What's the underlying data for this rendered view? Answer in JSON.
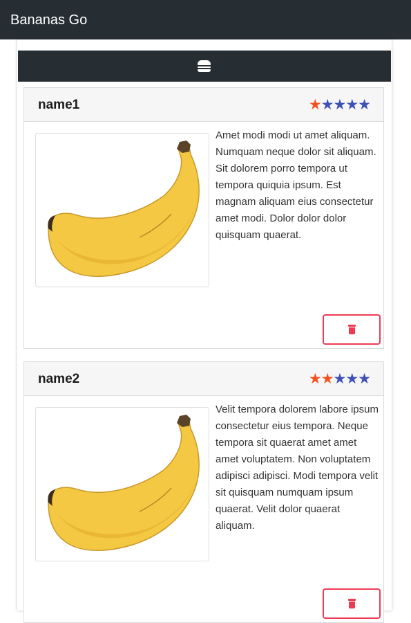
{
  "app": {
    "title": "Bananas Go"
  },
  "menu": {
    "icon": "hamburger-icon"
  },
  "cards": [
    {
      "name": "name1",
      "rating": 1,
      "max_rating": 5,
      "description": "Amet modi modi ut amet aliquam. Numquam neque dolor sit aliquam. Sit dolorem porro tempora ut tempora quiquia ipsum. Est magnam aliquam eius consectetur amet modi. Dolor dolor dolor quisquam quaerat.",
      "image": "banana",
      "delete_icon": "trash-icon"
    },
    {
      "name": "name2",
      "rating": 2,
      "max_rating": 5,
      "description": "Velit tempora dolorem labore ipsum consectetur eius tempora. Neque tempora sit quaerat amet amet amet voluptatem. Non voluptatem adipisci adipisci. Modi tempora velit sit quisquam numquam ipsum quaerat. Velit dolor quaerat aliquam.",
      "image": "banana",
      "delete_icon": "trash-icon"
    }
  ],
  "colors": {
    "navbar": "#262d33",
    "star_active": "#f4511e",
    "star_inactive": "#3f51b5",
    "delete_accent": "#f03a54"
  }
}
